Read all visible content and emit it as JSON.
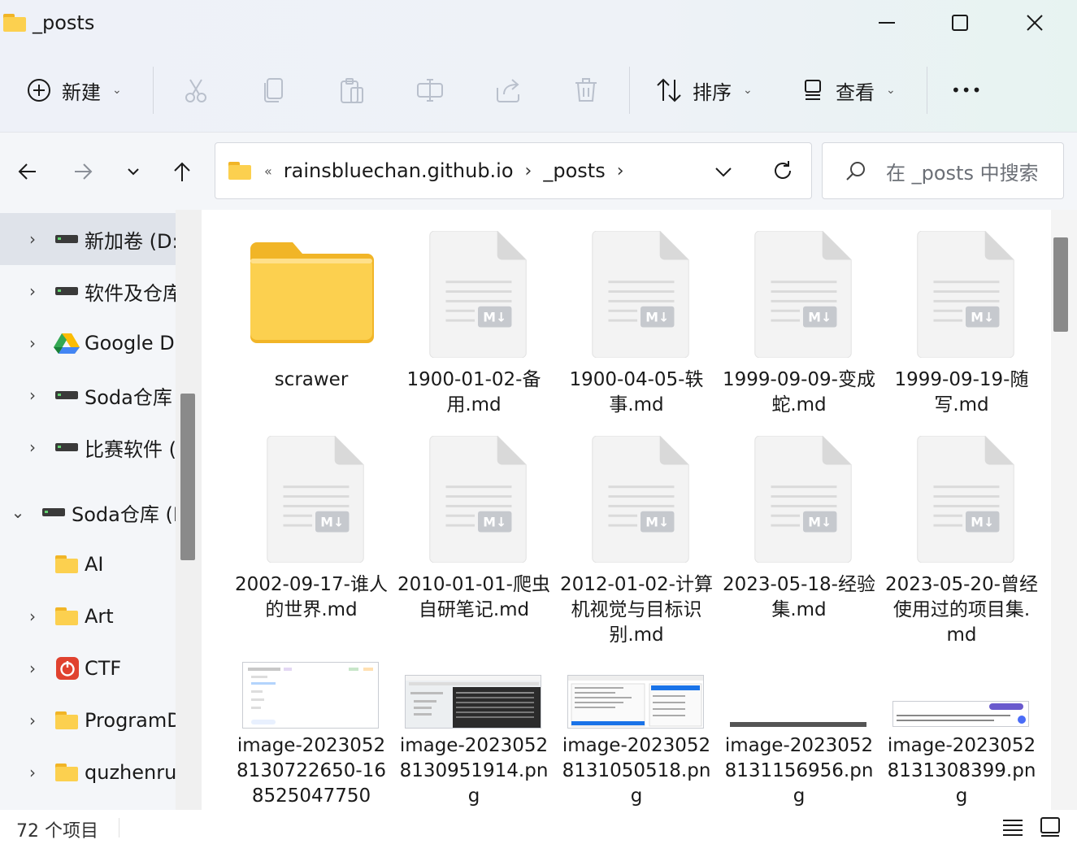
{
  "window": {
    "title": "_posts",
    "minimize_icon": "minimize-icon",
    "maximize_icon": "maximize-icon",
    "close_icon": "close-icon"
  },
  "toolbar": {
    "new_label": "新建",
    "sort_label": "排序",
    "view_label": "查看",
    "more_label": "•••"
  },
  "address": {
    "overflow_label": "«",
    "crumbs": [
      "rainsbluechan.github.io",
      "_posts"
    ],
    "search_placeholder": "在 _posts 中搜索"
  },
  "sidebar": {
    "items": [
      {
        "label": "新加卷 (D:",
        "icon": "drive-icon",
        "expander": "›",
        "selected": true
      },
      {
        "label": "软件及仓库",
        "icon": "drive-icon",
        "expander": "›"
      },
      {
        "label": "Google Dr",
        "icon": "google-drive-icon",
        "expander": "›"
      },
      {
        "label": "Soda仓库",
        "icon": "drive-icon",
        "expander": "›"
      },
      {
        "label": "比赛软件 (",
        "icon": "drive-icon",
        "expander": "›"
      },
      {
        "label": "Soda仓库 (H",
        "icon": "drive-icon",
        "expander": "⌄"
      },
      {
        "label": "AI",
        "icon": "folder-icon",
        "expander": ""
      },
      {
        "label": "Art",
        "icon": "folder-icon",
        "expander": "›"
      },
      {
        "label": "CTF",
        "icon": "ctf-app-icon",
        "expander": "›"
      },
      {
        "label": "ProgramD",
        "icon": "folder-icon",
        "expander": "›"
      },
      {
        "label": "quzhenru",
        "icon": "folder-icon",
        "expander": "›"
      }
    ]
  },
  "files": [
    {
      "name": "scrawer",
      "kind": "folder"
    },
    {
      "name": "1900-01-02-备用.md",
      "kind": "markdown"
    },
    {
      "name": "1900-04-05-轶事.md",
      "kind": "markdown"
    },
    {
      "name": "1999-09-09-变成蛇.md",
      "kind": "markdown"
    },
    {
      "name": "1999-09-19-随写.md",
      "kind": "markdown"
    },
    {
      "name": "2002-09-17-谁人的世界.md",
      "kind": "markdown"
    },
    {
      "name": "2010-01-01-爬虫自研笔记.md",
      "kind": "markdown"
    },
    {
      "name": "2012-01-02-计算机视觉与目标识别.md",
      "kind": "markdown"
    },
    {
      "name": "2023-05-18-经验集.md",
      "kind": "markdown"
    },
    {
      "name": "2023-05-20-曾经使用过的项目集.md",
      "kind": "markdown"
    },
    {
      "name": "image-20230528130722650-168525047750",
      "kind": "image"
    },
    {
      "name": "image-20230528130951914.png",
      "kind": "image"
    },
    {
      "name": "image-20230528131050518.png",
      "kind": "image"
    },
    {
      "name": "image-20230528131156956.png",
      "kind": "image"
    },
    {
      "name": "image-20230528131308399.png",
      "kind": "image"
    }
  ],
  "status": {
    "item_count": "72 个项目"
  },
  "colors": {
    "folder_back": "#f1b527",
    "folder_front": "#fcd04f",
    "selection": "#dfe3ea",
    "md_badge": "#c6c9ce"
  }
}
